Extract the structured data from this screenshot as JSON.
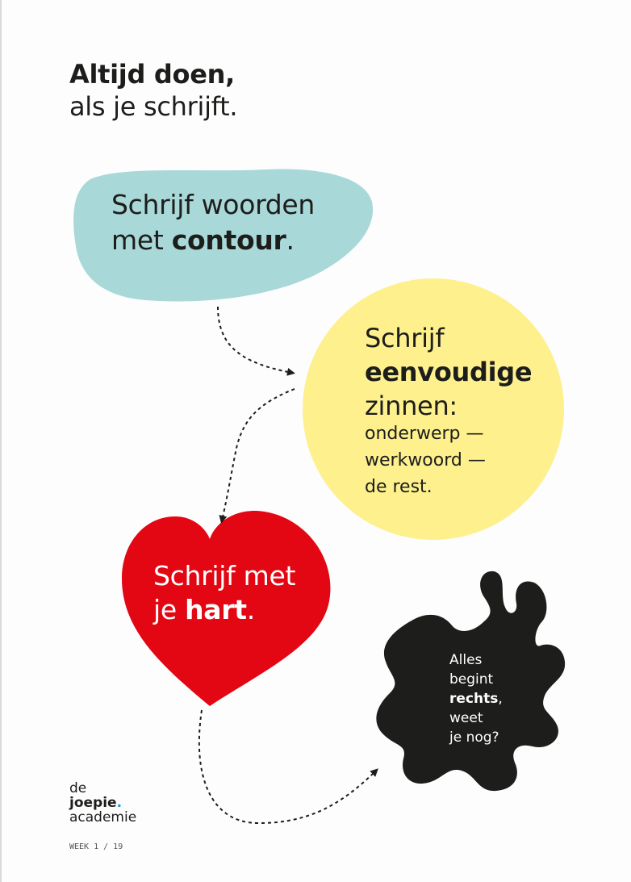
{
  "header": {
    "title_line1": "Altijd doen,",
    "title_line2": "als je schrijft."
  },
  "blue_blob": {
    "line1": "Schrijf woorden",
    "line2_prefix": "met ",
    "line2_bold": "contour",
    "line2_suffix": "."
  },
  "yellow_circle": {
    "line1": "Schrijf",
    "line2_bold": "eenvoudige",
    "line3": "zinnen:",
    "sub1": "onderwerp —",
    "sub2": "werkwoord —",
    "sub3": "de rest."
  },
  "heart": {
    "line1": "Schrijf met",
    "line2_prefix": "je ",
    "line2_bold": "hart",
    "line2_suffix": "."
  },
  "black_blob": {
    "line1": "Alles",
    "line2": "begint",
    "line3_bold": "rechts",
    "line3_suffix": ",",
    "line4": "weet",
    "line5": "je nog?"
  },
  "logo": {
    "line1": "de",
    "line2": "joepie",
    "line2_dot": ".",
    "line3": "academie"
  },
  "footer": {
    "page_label": "WEEK 1 / 19"
  },
  "colors": {
    "blue": "#a9d8d9",
    "yellow": "#fdf08d",
    "red": "#e30613",
    "black": "#1d1d1b",
    "logo_dot": "#1e9ad6"
  }
}
